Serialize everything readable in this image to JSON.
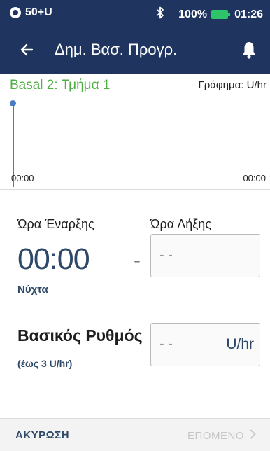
{
  "status_bar": {
    "pod_label": "50+U",
    "battery_percent": "100%",
    "time": "01:26",
    "colors": {
      "background": "#1f3560",
      "battery": "#2fc46a"
    }
  },
  "header": {
    "title": "Δημ. Βασ. Προγρ.",
    "back_icon": "arrow-left-icon",
    "notification_icon": "bell-icon"
  },
  "segment": {
    "title": "Basal 2: Τμήμα 1",
    "graph_unit": "Γράφημα: U/hr",
    "accent_color": "#4fae45"
  },
  "graph": {
    "start_tick": "00:00",
    "end_tick": "00:00",
    "line_color": "#4a7cc3"
  },
  "form": {
    "start_label": "Ώρα Έναρξης",
    "end_label": "Ώρα Λήξης",
    "start_value": "00:00",
    "separator": "-",
    "end_placeholder": "- -",
    "period_label": "Νύχτα",
    "rate_label": "Βασικός Ρυθμός",
    "rate_hint": "(έως 3 U/hr)",
    "rate_placeholder": "- -",
    "rate_unit": "U/hr"
  },
  "footer": {
    "cancel_label": "ΑΚΥΡΩΣΗ",
    "next_label": "ΕΠΟΜΕΝΟ",
    "next_icon": "chevron-right-icon"
  }
}
